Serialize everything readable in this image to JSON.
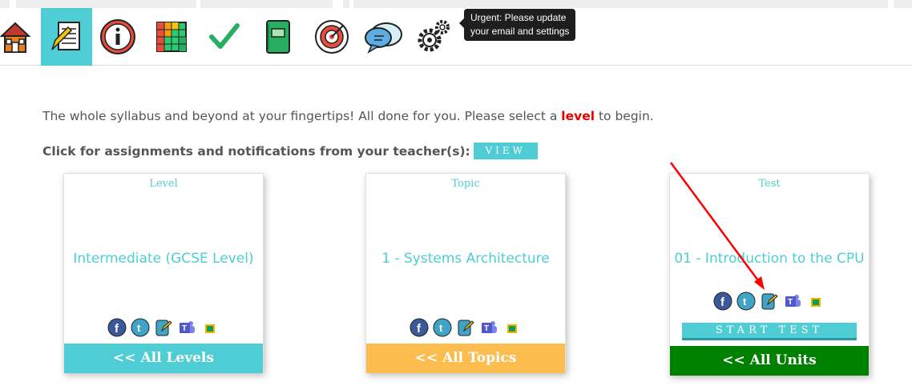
{
  "nav": {
    "items": [
      {
        "icon": "house-icon"
      },
      {
        "icon": "pencil-paper-icon",
        "active": true
      },
      {
        "icon": "info-icon"
      },
      {
        "icon": "grid-chart-icon"
      },
      {
        "icon": "checkmark-icon"
      },
      {
        "icon": "notebook-icon"
      },
      {
        "icon": "target-icon"
      },
      {
        "icon": "speech-bubbles-icon"
      },
      {
        "icon": "gears-icon"
      }
    ],
    "tooltip": "Urgent: Please update your email and settings"
  },
  "intro": {
    "before": "The whole syllabus and beyond at your fingertips! All done for you. Please select a ",
    "level_word": "level",
    "after": " to begin."
  },
  "assignments": {
    "label": "Click for assignments and notifications from your teacher(s):",
    "view_button": "VIEW"
  },
  "cards": {
    "level": {
      "heading": "Level",
      "title": "Intermediate (GCSE Level)",
      "footer": "<< All Levels",
      "footer_color": "#4ecdd4"
    },
    "topic": {
      "heading": "Topic",
      "title": "1 - Systems Architecture",
      "footer": "<< All Topics",
      "footer_color": "#fbbd4e"
    },
    "test": {
      "heading": "Test",
      "title": "01 - Introduction to the CPU",
      "footer": "<< All Units",
      "footer_color": "#008000",
      "start_button": "START TEST"
    }
  },
  "share_icons": [
    "facebook-icon",
    "twitter-icon",
    "share-edit-icon",
    "teams-icon",
    "classroom-icon"
  ],
  "colors": {
    "accent": "#4ecdd4",
    "highlight": "#e00000",
    "arrow": "#ff0000"
  }
}
